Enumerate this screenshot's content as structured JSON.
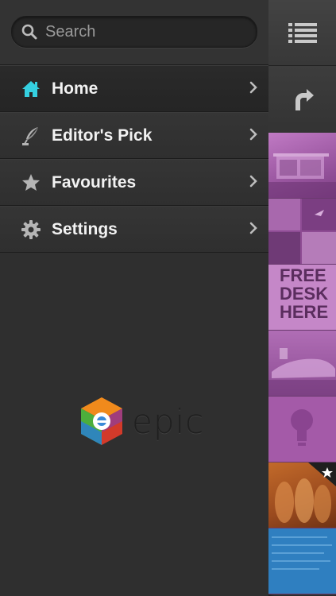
{
  "search": {
    "placeholder": "Search"
  },
  "menu": [
    {
      "label": "Home",
      "icon": "home-icon",
      "active": true
    },
    {
      "label": "Editor's Pick",
      "icon": "quill-icon",
      "active": false
    },
    {
      "label": "Favourites",
      "icon": "star-icon",
      "active": false
    },
    {
      "label": "Settings",
      "icon": "gear-icon",
      "active": false
    }
  ],
  "brand": {
    "name": "epic"
  },
  "thumbnails": [
    {
      "desc": "Modern glass house",
      "starred": false
    },
    {
      "desc": "Photo collage",
      "starred": false
    },
    {
      "text": "FREE DESK HERE",
      "starred": false
    },
    {
      "desc": "Sports car",
      "starred": false
    },
    {
      "desc": "Light bulb",
      "starred": false
    },
    {
      "desc": "Photo",
      "starred": true
    },
    {
      "desc": "Article text",
      "starred": false
    }
  ],
  "colors": {
    "accent": "#35d0e0",
    "thumbnail_tint": "#a45aa8",
    "drawer_bg": "#2f2f2f"
  }
}
